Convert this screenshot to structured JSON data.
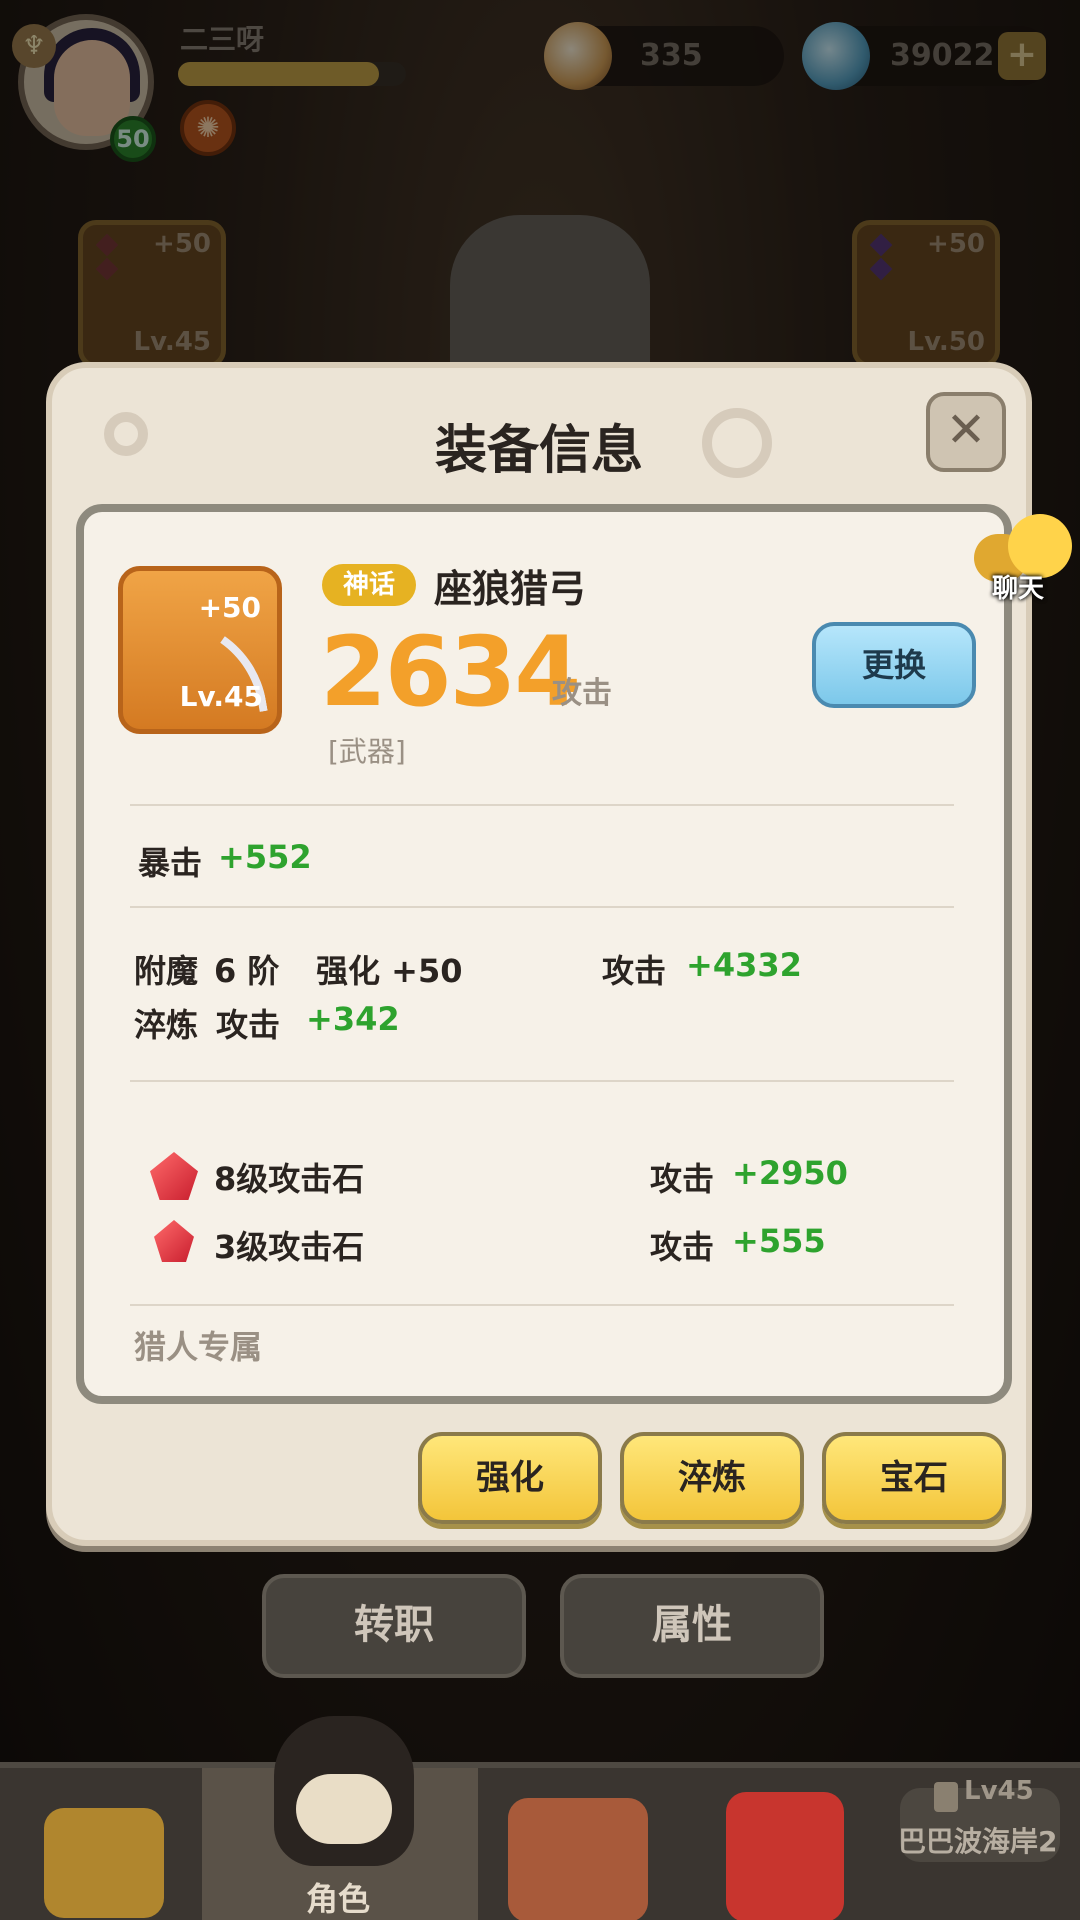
{
  "player": {
    "name": "二三呀",
    "level": "50",
    "xp_fraction": 0.88
  },
  "resources": [
    {
      "icon": "pearl-icon",
      "value": "335"
    },
    {
      "icon": "shell-icon",
      "value": "39022"
    }
  ],
  "equipped_slots": [
    {
      "plus": "+50",
      "level": "Lv.45"
    },
    {
      "plus": "+50",
      "level": "Lv.50"
    }
  ],
  "dialog": {
    "title": "装备信息",
    "item": {
      "rarity": "神话",
      "name": "座狼猎弓",
      "plus": "+50",
      "level": "Lv.45",
      "power": "2634",
      "power_label": "攻击",
      "slot_type": "[武器]",
      "swap_label": "更换"
    },
    "crit": {
      "label": "暴击",
      "value": "+552"
    },
    "enchant": {
      "label": "附魔",
      "tier": "6 阶",
      "enhance_label": "强化 +50",
      "attr": "攻击",
      "value": "+4332"
    },
    "refine": {
      "label": "淬炼",
      "attr": "攻击",
      "value": "+342"
    },
    "gems": [
      {
        "name": "8级攻击石",
        "attr": "攻击",
        "value": "+2950"
      },
      {
        "name": "3级攻击石",
        "attr": "攻击",
        "value": "+555"
      }
    ],
    "exclusive": "猎人专属",
    "buttons": [
      "强化",
      "淬炼",
      "宝石"
    ]
  },
  "chat_label": "聊天",
  "lower_buttons": [
    "转职",
    "属性"
  ],
  "nav": {
    "active_label": "角色",
    "region_level": "Lv45",
    "region_name": "巴巴波海岸2"
  },
  "colors": {
    "power": "#f3a02a",
    "bonus_green": "#2ea32e",
    "rarity_gold": "#e6b222",
    "swap_blue": "#7cc8ea",
    "action_yellow": "#f3c53a"
  }
}
